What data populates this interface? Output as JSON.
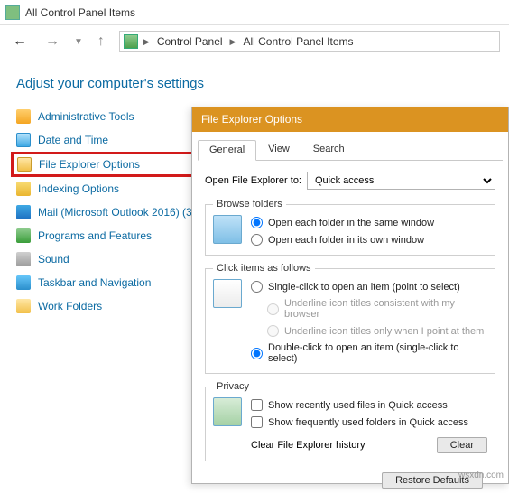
{
  "window": {
    "title": "All Control Panel Items"
  },
  "breadcrumb": {
    "a": "Control Panel",
    "b": "All Control Panel Items"
  },
  "heading": "Adjust your computer's settings",
  "cp": {
    "admin": "Administrative Tools",
    "date": "Date and Time",
    "feo": "File Explorer Options",
    "index": "Indexing Options",
    "mail": "Mail (Microsoft Outlook 2016) (3",
    "prog": "Programs and Features",
    "sound": "Sound",
    "task": "Taskbar and Navigation",
    "work": "Work Folders"
  },
  "dlg": {
    "title": "File Explorer Options",
    "tabs": {
      "general": "General",
      "view": "View",
      "search": "Search"
    },
    "openTo": {
      "label": "Open File Explorer to:",
      "value": "Quick access"
    },
    "browse": {
      "legend": "Browse folders",
      "same": "Open each folder in the same window",
      "own": "Open each folder in its own window"
    },
    "click": {
      "legend": "Click items as follows",
      "single": "Single-click to open an item (point to select)",
      "u1": "Underline icon titles consistent with my browser",
      "u2": "Underline icon titles only when I point at them",
      "double": "Double-click to open an item (single-click to select)"
    },
    "privacy": {
      "legend": "Privacy",
      "recent": "Show recently used files in Quick access",
      "freq": "Show frequently used folders in Quick access",
      "clearLab": "Clear File Explorer history",
      "clearBtn": "Clear"
    },
    "restore": "Restore Defaults"
  },
  "watermark": "wsxdn.com"
}
